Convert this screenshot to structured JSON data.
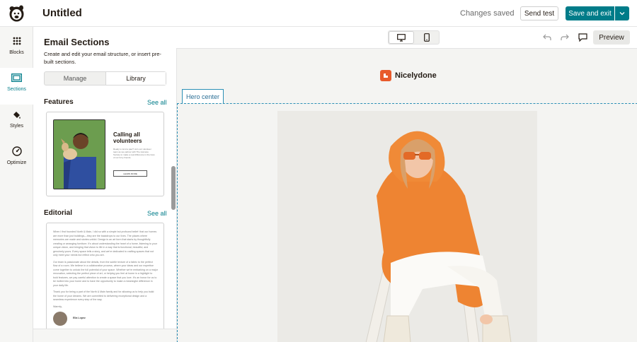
{
  "header": {
    "title": "Untitled",
    "status": "Changes saved",
    "send_test_label": "Send test",
    "save_exit_label": "Save and exit"
  },
  "rail": {
    "items": [
      {
        "label": "Blocks",
        "icon": "grid-icon"
      },
      {
        "label": "Sections",
        "icon": "sections-icon"
      },
      {
        "label": "Styles",
        "icon": "paint-bucket-icon"
      },
      {
        "label": "Optimize",
        "icon": "gauge-icon"
      }
    ]
  },
  "panel": {
    "title": "Email Sections",
    "description": "Create and edit your email structure, or insert pre-built sections.",
    "tabs": [
      {
        "label": "Manage"
      },
      {
        "label": "Library"
      }
    ],
    "selected_tab": "Library",
    "sections": [
      {
        "title": "Features",
        "see_all": "See all",
        "preview_heading": "Calling all volunteers",
        "preview_text": "Ready to lend a paw? Join our volunteer team as we partner with The Humane Society to make a real difference in the lives of our furry friends.",
        "preview_button": "LEARN MORE"
      },
      {
        "title": "Editorial",
        "see_all": "See all",
        "paragraphs": [
          "When I first founded North & Main, I did so with a simple but profound belief: that our homes are more than just buildings—they are the backdrops to our lives. The places where memories are made and stories unfold. Design is an art form that starts by thoughtfully creating or arranging furniture. It's about understanding the heart of a home, listening to your unique vision, and bringing that vision to life in a way that is functional, beautiful, and genuinely yours. Every space tells a story, and we're dedicated to crafting spaces that not only meet your needs but reflect who you are.",
          "Our team is passionate about the details, from the subtle texture of a fabric to the perfect flow of a room. We believe in a collaborative process, where your ideas and our expertise come together to unlock the full potential of your space. Whether we're embarking on a major renovation, selecting the perfect piece of art, or helping you feel at home in a highlight to bold features, we pay careful attention to create a space that you love. It's an honor for us to be invited into your home and to have the opportunity to make a meaningful difference in your daily life.",
          "Thank you for being a part of the North & Main family and for allowing us to help you build the home of your dreams. We are committed to delivering exceptional design and a seamless experience every step of the way.",
          "Warmly,"
        ],
        "signature": "Ella Lopez"
      }
    ]
  },
  "canvas": {
    "brand_name": "Nicelydone",
    "hero_label": "Hero center",
    "preview_label": "Preview"
  },
  "colors": {
    "accent": "#007c89",
    "brand": "#e85a2b",
    "selection": "#2b8fb5"
  }
}
